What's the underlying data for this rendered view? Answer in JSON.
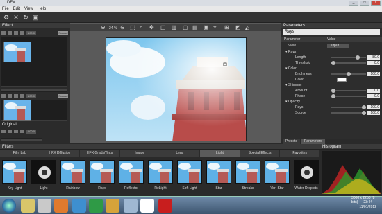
{
  "window": {
    "title": "DFX",
    "minimize": "_",
    "maximize": "□",
    "close": "x"
  },
  "menu": [
    "File",
    "Edit",
    "View",
    "Help"
  ],
  "effect_panel": {
    "title": "Effect",
    "layer1": {
      "opacity": "100.0",
      "mode": "Normal"
    },
    "layer2": {
      "opacity": "100.0",
      "mode": "Normal"
    },
    "original_label": "Original",
    "layer3": {
      "opacity": "100.0"
    }
  },
  "canvas": {
    "zoom": "24 %"
  },
  "parameters_panel": {
    "title": "Parameters",
    "preset_name": "Rays",
    "col_param": "Parameter",
    "col_value": "Value",
    "view_label": "View",
    "view_value": "Output",
    "rows": [
      {
        "label": "Rays",
        "kind": "group"
      },
      {
        "label": "Length",
        "kind": "slider",
        "value": "80.0",
        "level": 0.8
      },
      {
        "label": "Threshold",
        "kind": "slider",
        "value": "0.0",
        "level": 0.0
      },
      {
        "label": "Color",
        "kind": "group"
      },
      {
        "label": "Brightness",
        "kind": "slider",
        "value": "100.0",
        "level": 0.5
      },
      {
        "label": "Color",
        "kind": "swatch"
      },
      {
        "label": "Shimmer",
        "kind": "group"
      },
      {
        "label": "Amount",
        "kind": "slider",
        "value": "0.0",
        "level": 0.0
      },
      {
        "label": "Phase",
        "kind": "slider",
        "value": "0.0",
        "level": 0.0
      },
      {
        "label": "Opacity",
        "kind": "group"
      },
      {
        "label": "Rays",
        "kind": "slider",
        "value": "100.0",
        "level": 1.0
      },
      {
        "label": "Source",
        "kind": "slider",
        "value": "100.0",
        "level": 1.0
      }
    ],
    "tabs": [
      "Presets",
      "Parameters"
    ]
  },
  "filters": {
    "title": "Filters",
    "categories": [
      "Film Lab",
      "HFX Diffusion",
      "HFX Grads/Tints",
      "Image",
      "Lens",
      "Light",
      "Special Effects",
      "Favorites"
    ],
    "active_category": "Light",
    "items": [
      "Key Light",
      "Light",
      "Rainbow",
      "Rays",
      "Reflector",
      "ReLight",
      "Soft Light",
      "Star",
      "Streaks",
      "Vari-Star",
      "Water Droplets"
    ]
  },
  "histogram": {
    "title": "Histogram",
    "dims": "3000 x 2250 (8 bits)"
  },
  "taskbar": {
    "time": "23:44",
    "date": "11/01/2012"
  }
}
